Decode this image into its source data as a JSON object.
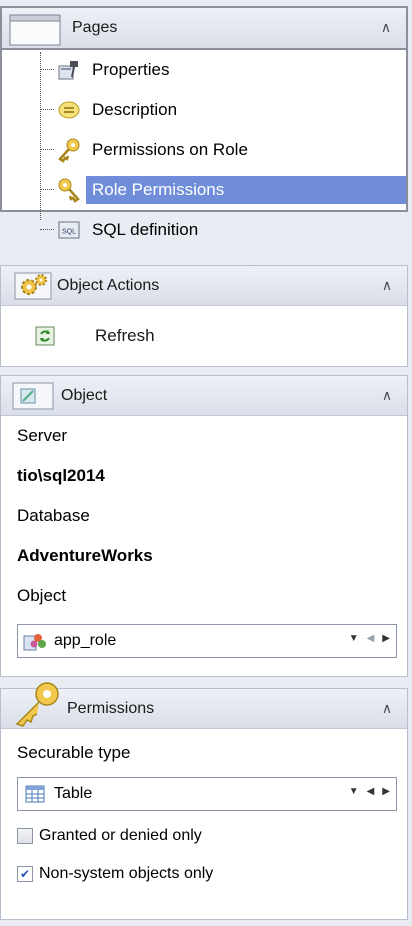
{
  "pages": {
    "title": "Pages",
    "items": [
      {
        "label": "Properties",
        "icon": "properties-icon"
      },
      {
        "label": "Description",
        "icon": "description-icon"
      },
      {
        "label": "Permissions on Role",
        "icon": "key-icon"
      },
      {
        "label": "Role Permissions",
        "icon": "key-icon",
        "selected": true
      },
      {
        "label": "SQL definition",
        "icon": "sql-icon"
      }
    ]
  },
  "object_actions": {
    "title": "Object Actions",
    "refresh_label": "Refresh"
  },
  "object": {
    "title": "Object",
    "server_label": "Server",
    "server_value": "tio\\sql2014",
    "database_label": "Database",
    "database_value": "AdventureWorks",
    "object_label": "Object",
    "object_value": "app_role"
  },
  "permissions": {
    "title": "Permissions",
    "securable_type_label": "Securable type",
    "securable_type_value": "Table",
    "granted_or_denied_label": "Granted or denied only",
    "granted_or_denied_checked": false,
    "non_system_label": "Non-system objects only",
    "non_system_checked": true
  },
  "colors": {
    "selection": "#6f8dd8",
    "header_top": "#eef1f6",
    "header_bottom": "#d9dee8"
  }
}
